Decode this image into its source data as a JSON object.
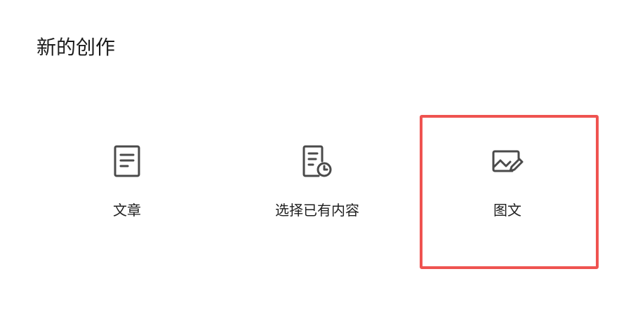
{
  "header": {
    "title": "新的创作"
  },
  "options": [
    {
      "label": "文章",
      "icon": "document-icon"
    },
    {
      "label": "选择已有内容",
      "icon": "document-clock-icon"
    },
    {
      "label": "图文",
      "icon": "image-edit-icon"
    }
  ],
  "highlight": {
    "color": "#ef5350",
    "target": "图文"
  },
  "colors": {
    "icon": "#4a4a4a",
    "text": "#1f1f1f"
  }
}
